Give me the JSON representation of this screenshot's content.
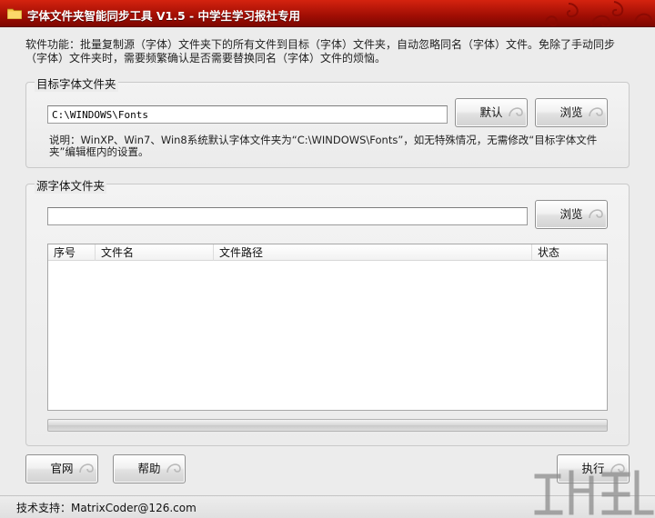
{
  "window": {
    "title": "字体文件夹智能同步工具 V1.5 - 中学生学习报社专用"
  },
  "description": "软件功能：批量复制源（字体）文件夹下的所有文件到目标（字体）文件夹，自动忽略同名（字体）文件。免除了手动同步（字体）文件夹时，需要频繁确认是否需要替换同名（字体）文件的烦恼。",
  "target_group": {
    "title": "目标字体文件夹",
    "path_value": "C:\\WINDOWS\\Fonts",
    "default_label": "默认",
    "browse_label": "浏览",
    "note": "说明：WinXP、Win7、Win8系统默认字体文件夹为“C:\\WINDOWS\\Fonts”，如无特殊情况，无需修改“目标字体文件夹”编辑框内的设置。"
  },
  "source_group": {
    "title": "源字体文件夹",
    "path_value": "",
    "browse_label": "浏览",
    "columns": [
      "序号",
      "文件名",
      "文件路径",
      "状态"
    ],
    "progress": 0
  },
  "footer_buttons": {
    "website_label": "官网",
    "help_label": "帮助",
    "execute_label": "执行"
  },
  "statusbar": {
    "text": "技术支持：MatrixCoder@126.com"
  },
  "colors": {
    "titlebar": "#b5140a",
    "window_bg": "#ececec"
  }
}
